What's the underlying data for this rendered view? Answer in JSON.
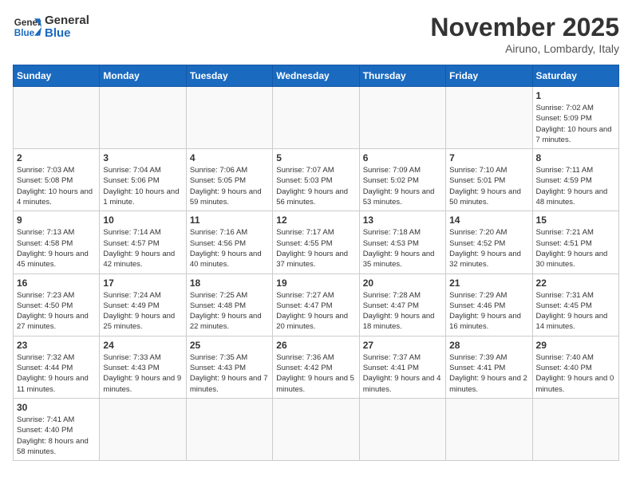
{
  "logo": {
    "general": "General",
    "blue": "Blue"
  },
  "title": "November 2025",
  "subtitle": "Airuno, Lombardy, Italy",
  "headers": [
    "Sunday",
    "Monday",
    "Tuesday",
    "Wednesday",
    "Thursday",
    "Friday",
    "Saturday"
  ],
  "weeks": [
    [
      {
        "day": "",
        "info": ""
      },
      {
        "day": "",
        "info": ""
      },
      {
        "day": "",
        "info": ""
      },
      {
        "day": "",
        "info": ""
      },
      {
        "day": "",
        "info": ""
      },
      {
        "day": "",
        "info": ""
      },
      {
        "day": "1",
        "info": "Sunrise: 7:02 AM\nSunset: 5:09 PM\nDaylight: 10 hours and 7 minutes."
      }
    ],
    [
      {
        "day": "2",
        "info": "Sunrise: 7:03 AM\nSunset: 5:08 PM\nDaylight: 10 hours and 4 minutes."
      },
      {
        "day": "3",
        "info": "Sunrise: 7:04 AM\nSunset: 5:06 PM\nDaylight: 10 hours and 1 minute."
      },
      {
        "day": "4",
        "info": "Sunrise: 7:06 AM\nSunset: 5:05 PM\nDaylight: 9 hours and 59 minutes."
      },
      {
        "day": "5",
        "info": "Sunrise: 7:07 AM\nSunset: 5:03 PM\nDaylight: 9 hours and 56 minutes."
      },
      {
        "day": "6",
        "info": "Sunrise: 7:09 AM\nSunset: 5:02 PM\nDaylight: 9 hours and 53 minutes."
      },
      {
        "day": "7",
        "info": "Sunrise: 7:10 AM\nSunset: 5:01 PM\nDaylight: 9 hours and 50 minutes."
      },
      {
        "day": "8",
        "info": "Sunrise: 7:11 AM\nSunset: 4:59 PM\nDaylight: 9 hours and 48 minutes."
      }
    ],
    [
      {
        "day": "9",
        "info": "Sunrise: 7:13 AM\nSunset: 4:58 PM\nDaylight: 9 hours and 45 minutes."
      },
      {
        "day": "10",
        "info": "Sunrise: 7:14 AM\nSunset: 4:57 PM\nDaylight: 9 hours and 42 minutes."
      },
      {
        "day": "11",
        "info": "Sunrise: 7:16 AM\nSunset: 4:56 PM\nDaylight: 9 hours and 40 minutes."
      },
      {
        "day": "12",
        "info": "Sunrise: 7:17 AM\nSunset: 4:55 PM\nDaylight: 9 hours and 37 minutes."
      },
      {
        "day": "13",
        "info": "Sunrise: 7:18 AM\nSunset: 4:53 PM\nDaylight: 9 hours and 35 minutes."
      },
      {
        "day": "14",
        "info": "Sunrise: 7:20 AM\nSunset: 4:52 PM\nDaylight: 9 hours and 32 minutes."
      },
      {
        "day": "15",
        "info": "Sunrise: 7:21 AM\nSunset: 4:51 PM\nDaylight: 9 hours and 30 minutes."
      }
    ],
    [
      {
        "day": "16",
        "info": "Sunrise: 7:23 AM\nSunset: 4:50 PM\nDaylight: 9 hours and 27 minutes."
      },
      {
        "day": "17",
        "info": "Sunrise: 7:24 AM\nSunset: 4:49 PM\nDaylight: 9 hours and 25 minutes."
      },
      {
        "day": "18",
        "info": "Sunrise: 7:25 AM\nSunset: 4:48 PM\nDaylight: 9 hours and 22 minutes."
      },
      {
        "day": "19",
        "info": "Sunrise: 7:27 AM\nSunset: 4:47 PM\nDaylight: 9 hours and 20 minutes."
      },
      {
        "day": "20",
        "info": "Sunrise: 7:28 AM\nSunset: 4:47 PM\nDaylight: 9 hours and 18 minutes."
      },
      {
        "day": "21",
        "info": "Sunrise: 7:29 AM\nSunset: 4:46 PM\nDaylight: 9 hours and 16 minutes."
      },
      {
        "day": "22",
        "info": "Sunrise: 7:31 AM\nSunset: 4:45 PM\nDaylight: 9 hours and 14 minutes."
      }
    ],
    [
      {
        "day": "23",
        "info": "Sunrise: 7:32 AM\nSunset: 4:44 PM\nDaylight: 9 hours and 11 minutes."
      },
      {
        "day": "24",
        "info": "Sunrise: 7:33 AM\nSunset: 4:43 PM\nDaylight: 9 hours and 9 minutes."
      },
      {
        "day": "25",
        "info": "Sunrise: 7:35 AM\nSunset: 4:43 PM\nDaylight: 9 hours and 7 minutes."
      },
      {
        "day": "26",
        "info": "Sunrise: 7:36 AM\nSunset: 4:42 PM\nDaylight: 9 hours and 5 minutes."
      },
      {
        "day": "27",
        "info": "Sunrise: 7:37 AM\nSunset: 4:41 PM\nDaylight: 9 hours and 4 minutes."
      },
      {
        "day": "28",
        "info": "Sunrise: 7:39 AM\nSunset: 4:41 PM\nDaylight: 9 hours and 2 minutes."
      },
      {
        "day": "29",
        "info": "Sunrise: 7:40 AM\nSunset: 4:40 PM\nDaylight: 9 hours and 0 minutes."
      }
    ],
    [
      {
        "day": "30",
        "info": "Sunrise: 7:41 AM\nSunset: 4:40 PM\nDaylight: 8 hours and 58 minutes."
      },
      {
        "day": "",
        "info": ""
      },
      {
        "day": "",
        "info": ""
      },
      {
        "day": "",
        "info": ""
      },
      {
        "day": "",
        "info": ""
      },
      {
        "day": "",
        "info": ""
      },
      {
        "day": "",
        "info": ""
      }
    ]
  ]
}
